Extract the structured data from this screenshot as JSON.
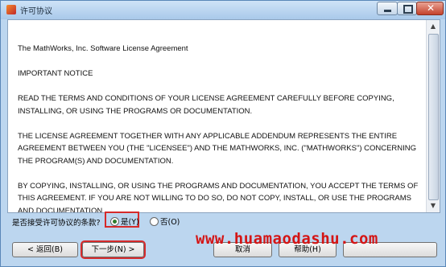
{
  "window": {
    "title": "许可协议"
  },
  "window_controls": {
    "minimize": "minimize",
    "maximize": "maximize",
    "close": "close"
  },
  "agreement": {
    "paragraphs": [
      "The MathWorks, Inc. Software License Agreement",
      "IMPORTANT NOTICE",
      "READ THE TERMS AND CONDITIONS OF YOUR LICENSE AGREEMENT CAREFULLY BEFORE COPYING, INSTALLING, OR USING THE PROGRAMS OR DOCUMENTATION.",
      "THE LICENSE AGREEMENT TOGETHER WITH ANY APPLICABLE ADDENDUM REPRESENTS THE ENTIRE AGREEMENT BETWEEN YOU (THE \"LICENSEE\") AND THE MATHWORKS, INC. (\"MATHWORKS\") CONCERNING THE PROGRAM(S) AND DOCUMENTATION.",
      "BY COPYING, INSTALLING, OR USING THE PROGRAMS AND DOCUMENTATION, YOU ACCEPT THE TERMS OF THIS AGREEMENT. IF YOU ARE NOT WILLING TO DO SO, DO NOT COPY, INSTALL, OR USE THE PROGRAMS AND DOCUMENTATION."
    ]
  },
  "consent": {
    "question": "是否接受许可协议的条款?",
    "yes_label": "是(Y)",
    "no_label": "否(O)",
    "selected": "yes"
  },
  "buttons": {
    "back": "< 返回(B)",
    "next": "下一步(N) >",
    "cancel": "取消",
    "help": "帮助(H)"
  },
  "watermark": "www.huamaodashu.com"
}
